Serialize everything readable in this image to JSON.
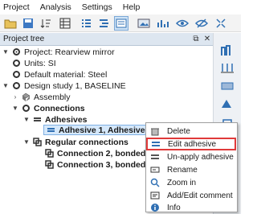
{
  "menubar": {
    "items": [
      "Project",
      "Analysis",
      "Settings",
      "Help"
    ]
  },
  "panel": {
    "title": "Project tree",
    "pin_icon": "pin-icon",
    "close_icon": "close-icon"
  },
  "tree": {
    "project": "Project: Rearview mirror",
    "units": "Units: SI",
    "material": "Default material: Steel",
    "study": "Design study 1, BASELINE",
    "assembly": "Assembly",
    "connections": "Connections",
    "adhesives": "Adhesives",
    "adhesive1": "Adhesive 1, Adhesive",
    "regular": "Regular connections",
    "conn2": "Connection 2, bonded",
    "conn3": "Connection 3, bonded"
  },
  "context_menu": {
    "items": [
      {
        "label": "Delete",
        "icon": "delete-icon"
      },
      {
        "label": "Edit adhesive",
        "icon": "edit-adhesive-icon",
        "highlighted": true
      },
      {
        "label": "Un-apply adhesive",
        "icon": "unapply-adhesive-icon"
      },
      {
        "label": "Rename",
        "icon": "rename-icon"
      },
      {
        "label": "Zoom in",
        "icon": "zoom-icon"
      },
      {
        "label": "Add/Edit comment",
        "icon": "comment-icon"
      },
      {
        "label": "Info",
        "icon": "info-icon"
      }
    ]
  },
  "colors": {
    "accent": "#2f6fb3",
    "highlight_border": "#e03a3a",
    "selection": "#d5e8fb"
  }
}
